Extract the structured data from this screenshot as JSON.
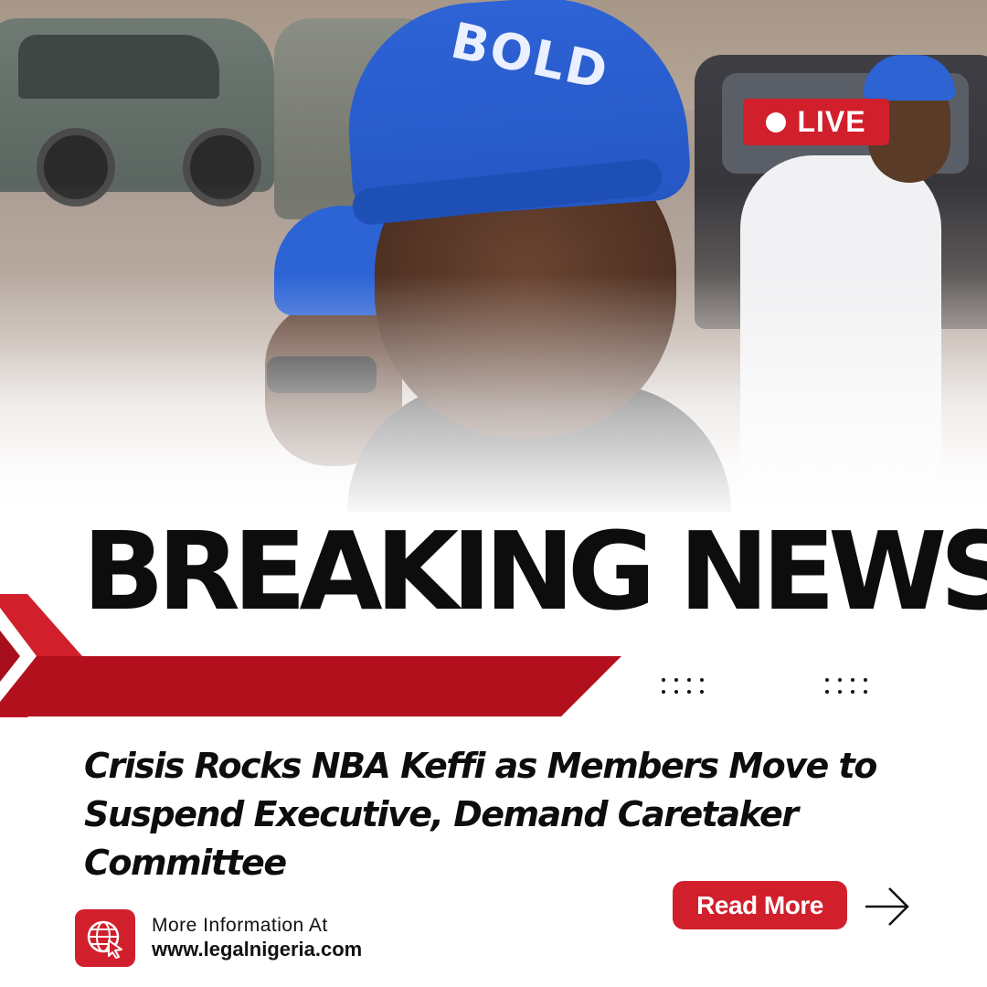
{
  "badge": {
    "live_label": "LIVE"
  },
  "cap_text": "BOLD",
  "headline": "BREAKING NEWS",
  "subheadline": "Crisis Rocks NBA Keffi as Members Move to Suspend Executive, Demand Caretaker Committee",
  "cta": {
    "read_more_label": "Read More",
    "arrow_icon": "arrow-right-icon"
  },
  "footer": {
    "icon": "globe-cursor-icon",
    "info_label": "More Information At",
    "website": "www.legalnigeria.com"
  },
  "colors": {
    "accent": "#d21f2c",
    "accent_dark": "#a80f1c",
    "text": "#0d0d0d",
    "cap_blue": "#2c63d5"
  }
}
